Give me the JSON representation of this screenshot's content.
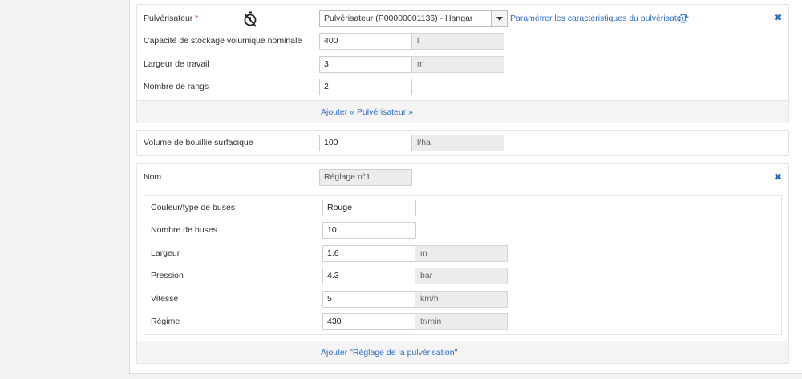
{
  "sprayer_card": {
    "sprayer_label": "Pulvérisateur",
    "required_mark": "*",
    "sprayer_select_value": "Pulvérisateur (P00000001136) - Hangar",
    "configure_link": "Paramétrer les caractéristiques du pulvérisateur",
    "fields": [
      {
        "label": "Capacité de stockage volumique nominale",
        "value": "400",
        "unit": "l"
      },
      {
        "label": "Largeur de travail",
        "value": "3",
        "unit": "m"
      },
      {
        "label": "Nombre de rangs",
        "value": "2"
      }
    ],
    "add_link": "Ajouter « Pulvérisateur »"
  },
  "volume_card": {
    "label": "Volume de bouillie surfacique",
    "value": "100",
    "unit": "l/ha"
  },
  "setting_card": {
    "name_label": "Nom",
    "name_value": "Réglage n°1",
    "fields": [
      {
        "label": "Couleur/type de buses",
        "value": "Rouge"
      },
      {
        "label": "Nombre de buses",
        "value": "10"
      },
      {
        "label": "Largeur",
        "value": "1.6",
        "unit": "m"
      },
      {
        "label": "Pression",
        "value": "4.3",
        "unit": "bar"
      },
      {
        "label": "Vitesse",
        "value": "5",
        "unit": "km/h"
      },
      {
        "label": "Régime",
        "value": "430",
        "unit": "tr/min"
      }
    ],
    "add_link": "Ajouter \"Réglage de la pulvérisation\""
  },
  "icons": {
    "stopwatch": "stopwatch-off-icon",
    "refresh": "refresh-icon",
    "remove": "close-icon",
    "dropdown": "caret-down-icon"
  },
  "colors": {
    "link": "#2f6fc5",
    "required": "#d9534f"
  }
}
